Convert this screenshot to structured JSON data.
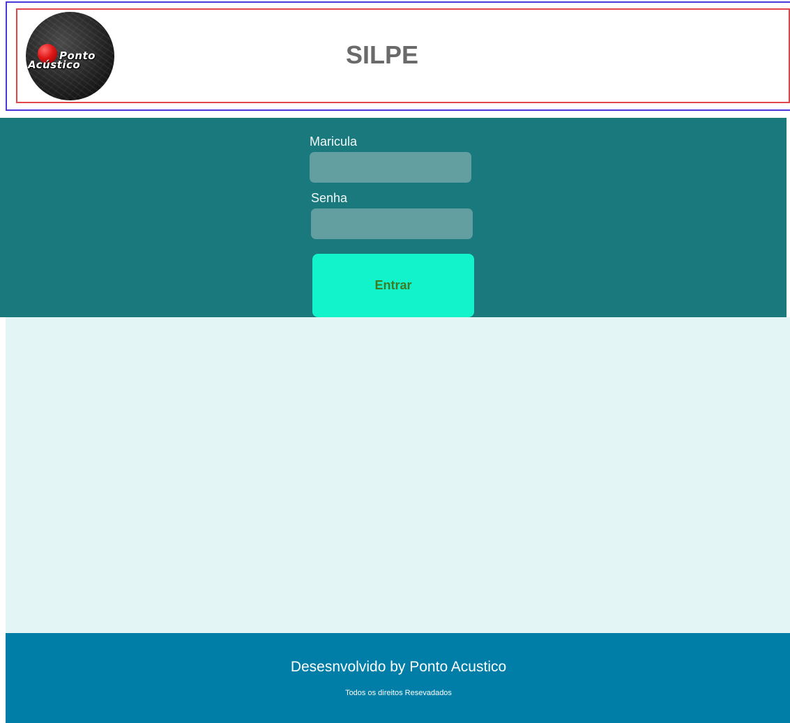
{
  "header": {
    "title": "SILPE",
    "logo": {
      "line1": "Ponto",
      "line2": "Acústico"
    }
  },
  "login": {
    "matricula_label": "Maricula",
    "matricula_value": "",
    "senha_label": "Senha",
    "senha_value": "",
    "submit_label": "Entrar"
  },
  "footer": {
    "credit": "Desesnvolvido by Ponto Acustico",
    "rights": "Todos os direitos Resevadados"
  },
  "colors": {
    "login_band": "#1a797d",
    "input_bg": "#639fa0",
    "button_bg": "#12f2cb",
    "button_text": "#3e7c24",
    "main_bg": "#e3f6f5",
    "footer_bg": "#007ea7",
    "title_text": "#6a6a6a"
  }
}
